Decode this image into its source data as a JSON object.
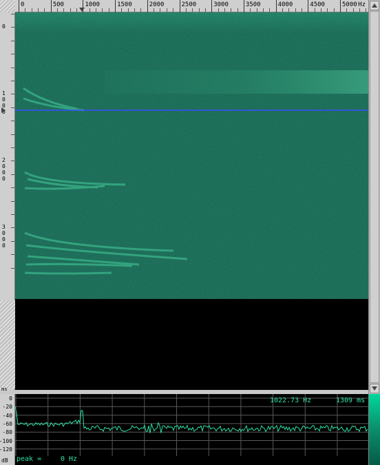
{
  "freq_ruler": {
    "unit": "Hz",
    "ticks": [
      "0",
      "500",
      "1000",
      "1500",
      "2000",
      "2500",
      "3000",
      "3500",
      "4000",
      "4500",
      "5000"
    ]
  },
  "time_ruler": {
    "unit": "ms",
    "ticks": [
      "0",
      "1000",
      "2000",
      "3000"
    ],
    "cursor_ms": 1309
  },
  "spectrum": {
    "db_ticks": [
      "0",
      "-20",
      "-40",
      "-60",
      "-80",
      "-100",
      "-120"
    ],
    "db_unit": "dB",
    "cursor_freq": "1022.73 Hz",
    "cursor_time": "1309 ms",
    "peak_label": "peak =",
    "peak_value": "0 Hz"
  },
  "colors": {
    "spectrogram_bg": "#0f5a45",
    "signal": "#2fe3a6",
    "cursor_line": "#3b4dff",
    "grid": "#5a5a5a"
  },
  "icons": [
    "scroll-up-arrow-icon",
    "scroll-down-arrow-icon",
    "freq-cursor-marker-icon",
    "time-cursor-marker-icon"
  ]
}
